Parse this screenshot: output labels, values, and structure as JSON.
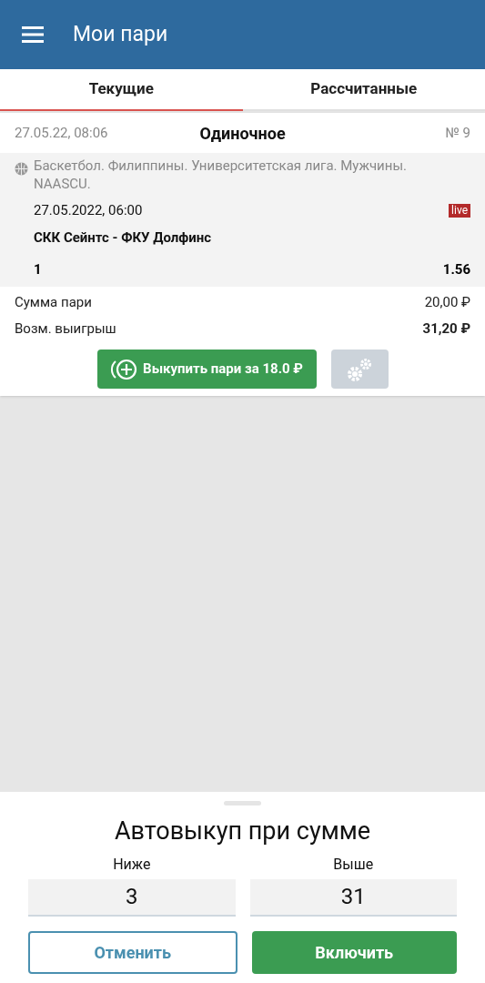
{
  "header": {
    "title": "Мои пари"
  },
  "tabs": [
    {
      "label": "Текущие",
      "selected": true
    },
    {
      "label": "Рассчитанные",
      "selected": false
    }
  ],
  "bet": {
    "date": "27.05.22, 08:06",
    "type": "Одиночное",
    "number": "№ 9",
    "event": {
      "league": "Баскетбол. Филиппины. Университетская лига. Мужчины. NAASCU.",
      "start": "27.05.2022, 06:00",
      "live": true,
      "live_label": "live",
      "teams": "СКК Сейнтс - ФКУ Долфинс",
      "outcome": "1",
      "odds": "1.56"
    },
    "rows": [
      {
        "label": "Сумма пари",
        "value": "20,00 ₽",
        "bold": false
      },
      {
        "label": "Возм. выигрыш",
        "value": "31,20 ₽",
        "bold": true
      }
    ],
    "cashout_button": "Выкупить пари за 18.0 ₽",
    "settings_disabled": true
  },
  "sheet": {
    "title": "Автовыкуп при сумме",
    "fields": [
      {
        "label": "Ниже",
        "value": "3"
      },
      {
        "label": "Выше",
        "value": "31"
      }
    ],
    "cancel": "Отменить",
    "confirm": "Включить"
  }
}
